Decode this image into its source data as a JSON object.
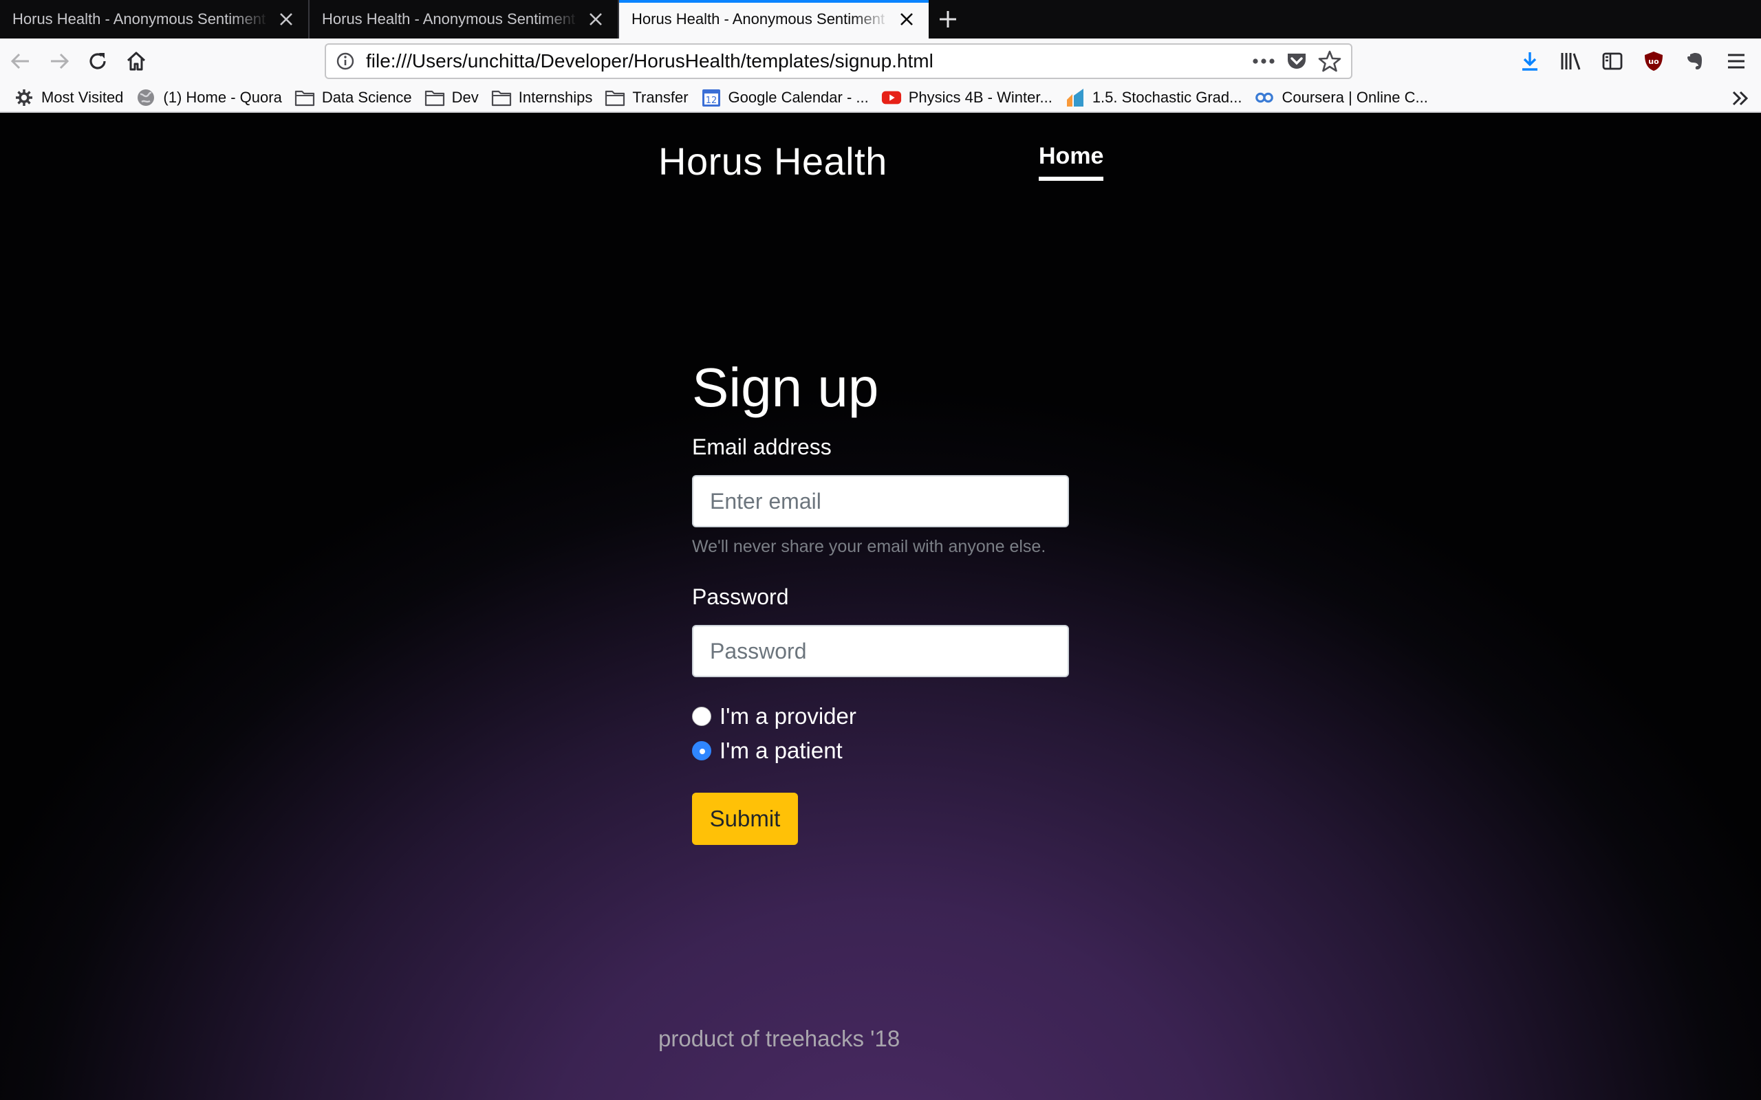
{
  "browser": {
    "tabs": [
      {
        "title": "Horus Health - Anonymous Sentiment",
        "active": false
      },
      {
        "title": "Horus Health - Anonymous Sentiment",
        "active": false
      },
      {
        "title": "Horus Health - Anonymous Sentiment",
        "active": true
      }
    ],
    "url": "file:///Users/unchitta/Developer/HorusHealth/templates/signup.html",
    "bookmarks": [
      {
        "label": "Most Visited",
        "icon": "gear-icon"
      },
      {
        "label": "(1) Home - Quora",
        "icon": "globe-icon"
      },
      {
        "label": "Data Science",
        "icon": "folder-icon"
      },
      {
        "label": "Dev",
        "icon": "folder-icon"
      },
      {
        "label": "Internships",
        "icon": "folder-icon"
      },
      {
        "label": "Transfer",
        "icon": "folder-icon"
      },
      {
        "label": "Google Calendar - ...",
        "icon": "calendar-icon"
      },
      {
        "label": "Physics 4B - Winter...",
        "icon": "youtube-icon"
      },
      {
        "label": "1.5. Stochastic Grad...",
        "icon": "scikit-icon"
      },
      {
        "label": "Coursera | Online C...",
        "icon": "coursera-icon"
      }
    ],
    "calendar_badge": "12"
  },
  "site": {
    "brand": "Horus Health",
    "nav_home": "Home"
  },
  "form": {
    "title": "Sign up",
    "email_label": "Email address",
    "email_placeholder": "Enter email",
    "email_value": "",
    "email_help": "We'll never share your email with anyone else.",
    "password_label": "Password",
    "password_placeholder": "Password",
    "password_value": "",
    "radios": [
      {
        "label": "I'm a provider",
        "checked": false
      },
      {
        "label": "I'm a patient",
        "checked": true
      }
    ],
    "submit_label": "Submit"
  },
  "footer": "product of treehacks '18",
  "colors": {
    "accent": "#0a84ff",
    "submit": "#ffc107",
    "radio_checked": "#2f86ff"
  }
}
